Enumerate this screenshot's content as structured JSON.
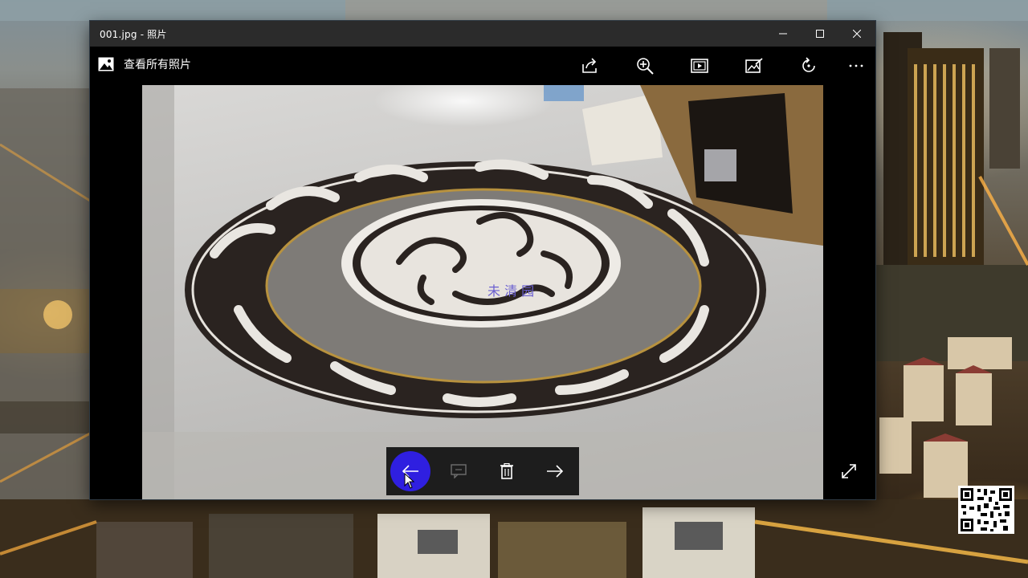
{
  "window": {
    "title": "001.jpg - 照片",
    "controls": {
      "minimize": "minimize-icon",
      "maximize": "maximize-icon",
      "close": "close-icon"
    }
  },
  "appbar": {
    "back_label": "查看所有照片",
    "back_icon": "photos-app-icon",
    "tools": [
      "share-icon",
      "zoom-in-icon",
      "slideshow-icon",
      "edit-icon",
      "rotate-icon",
      "more-icon"
    ]
  },
  "photo": {
    "overlay_text": "未 清 园"
  },
  "navigation": {
    "prev_icon": "arrow-left-icon",
    "accent_color": "#2f1fe0",
    "items": [
      "arrow-left-icon",
      "comment-icon",
      "delete-icon",
      "arrow-right-icon"
    ]
  },
  "fullscreen_icon": "expand-icon"
}
